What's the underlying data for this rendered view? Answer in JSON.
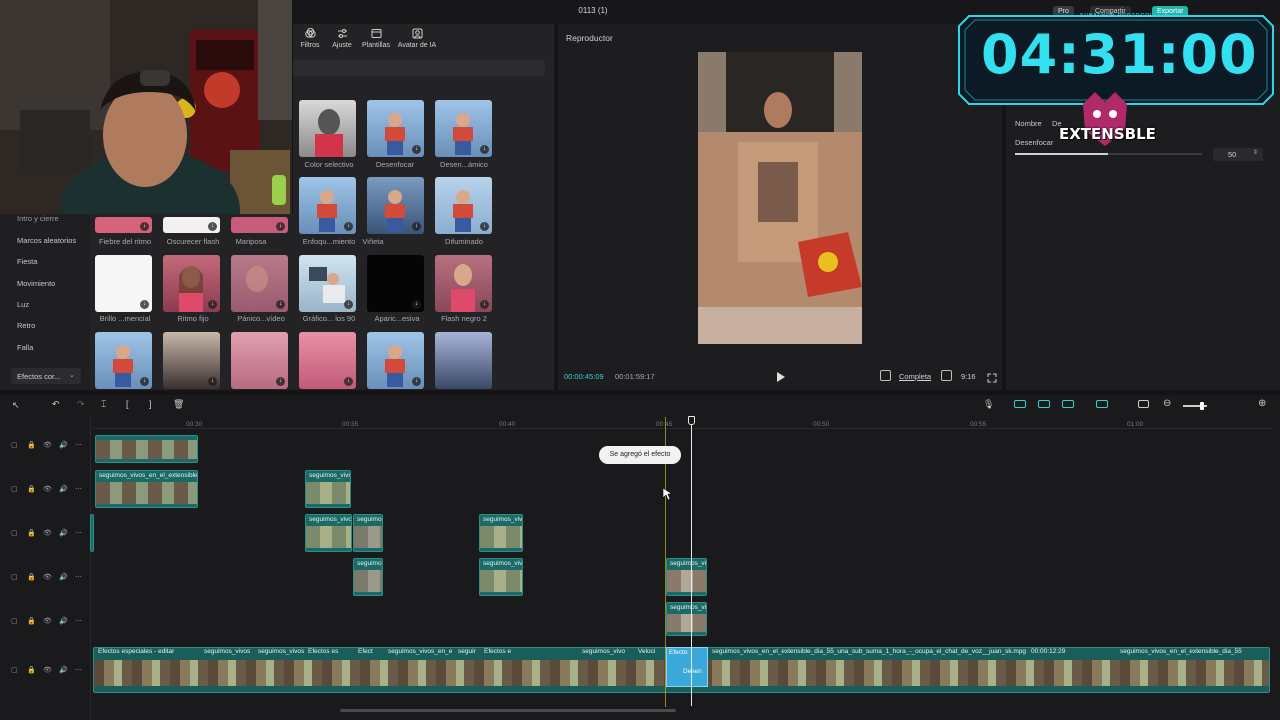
{
  "window": {
    "title": "0113 (1)",
    "pro_badge": "Pro",
    "share_label": "Compartir",
    "export_label": "Exportar"
  },
  "media_toolbar": {
    "items": [
      "Filtros",
      "Ajuste",
      "Plantillas",
      "Avatar de IA"
    ]
  },
  "categories": [
    "Intro y cierre",
    "Marcos aleatorios",
    "Fiesta",
    "Movimiento",
    "Luz",
    "Retro",
    "Falla"
  ],
  "category_dropdown": "Efectos cor...",
  "effect_row0": [
    "Color selectivo",
    "Desenfocar",
    "Desen...ámico"
  ],
  "effect_row1": [
    "Fiebre del ritmo",
    "Oscurecer flash",
    "Mariposa",
    "Enfoqu...miento",
    "Viñeta",
    "Difuminado"
  ],
  "effect_row2": [
    "Brillo ...mencial",
    "Ritmo fijo",
    "Pánico...vídeo",
    "Gráfico... los 90",
    "Aparic...esiva",
    "Flash negro 2"
  ],
  "player": {
    "title": "Reproductor",
    "current_time": "00:00:45:09",
    "total_time": "00:01:59:17",
    "quality": "Completa",
    "ratio": "9:16"
  },
  "right_panel": {
    "name_label": "Nombre",
    "name_value": "De",
    "blur_label": "Desenfocar",
    "blur_value": "50",
    "blur_fraction": 0.5
  },
  "overlay": {
    "subathon": "SUBATHON PROTOCOL",
    "timer": "04:31:00",
    "brand": "EXTENSBLE"
  },
  "timeline": {
    "ruler": [
      "00:30",
      "00:35",
      "00:40",
      "00:45",
      "00:50",
      "00:55",
      "01:00"
    ],
    "toast": "Se agregó el efecto",
    "clip_v1": "seguimos_vivos_en_el_extensible",
    "clip_short": "seguimos_vivo",
    "clip_short2": "seguimo",
    "clip_short3": "seguimos_viv",
    "main_labels": {
      "a": "Efectos especiales - editar",
      "b": "seguimos_vivos",
      "c": "Efectos es",
      "d": "Efect",
      "e": "seguimos_vivos_en_e",
      "f": "seguir",
      "g": "Efectos e",
      "h": "seguimos_vivo",
      "i": "Veloci",
      "j": "Efecto",
      "k": "Desen",
      "l": "seguimos_vivos_en_el_extensible_dia_55_una_sub_suma_1_hora_-_ocupa_el_chat_de_voz__juan_sk.mpg",
      "m": "00:00:12:29",
      "n": "seguimos_vivos_en_el_extensible_dia_55"
    }
  },
  "colors": {
    "accent": "#2fd4c9",
    "clip": "#1b6a66",
    "playhead": "#e8e8e8",
    "timer": "#33e0f0"
  }
}
